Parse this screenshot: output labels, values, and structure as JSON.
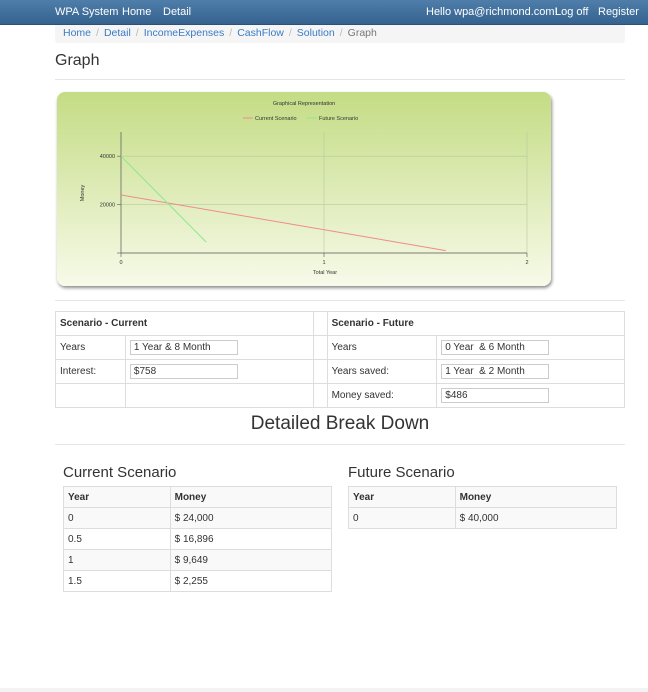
{
  "navbar": {
    "brand": "WPA System",
    "links": [
      "Home",
      "Detail"
    ],
    "greeting": "Hello wpa@richmond.com!",
    "logoff": "Log off",
    "register": "Register"
  },
  "breadcrumb": {
    "items": [
      "Home",
      "Detail",
      "IncomeExpenses",
      "CashFlow",
      "Solution"
    ],
    "active": "Graph"
  },
  "page_title": "Graph",
  "chart_data": {
    "type": "line",
    "title": "Graphical Representation",
    "xlabel": "Total Year",
    "ylabel": "Money",
    "xlim": [
      0,
      2
    ],
    "ylim": [
      0,
      50000
    ],
    "xticks": [
      "0",
      "1",
      "2"
    ],
    "yticks": [
      "20000",
      "40000"
    ],
    "grid": true,
    "legend": "top-center",
    "series": [
      {
        "name": "Current Scenario",
        "color": "#f08a8a",
        "x": [
          0,
          1.6
        ],
        "y": [
          24000,
          1000
        ]
      },
      {
        "name": "Future Scenario",
        "color": "#8fe88f",
        "x": [
          0,
          0.42
        ],
        "y": [
          40000,
          4500
        ]
      }
    ]
  },
  "scenario": {
    "current_header": "Scenario - Current",
    "future_header": "Scenario - Future",
    "current": {
      "years_label": "Years",
      "years_value": "1 Year & 8 Month",
      "interest_label": "Interest:",
      "interest_value": "$758"
    },
    "future": {
      "years_label": "Years",
      "years_value": "0 Year  & 6 Month",
      "years_saved_label": "Years saved:",
      "years_saved_value": "1 Year  & 2 Month",
      "money_saved_label": "Money saved:",
      "money_saved_value": "$486"
    }
  },
  "breakdown": {
    "heading": "Detailed Break Down",
    "current": {
      "title": "Current Scenario",
      "columns": [
        "Year",
        "Money"
      ],
      "rows": [
        [
          "0",
          "$ 24,000"
        ],
        [
          "0.5",
          "$ 16,896"
        ],
        [
          "1",
          "$ 9,649"
        ],
        [
          "1.5",
          "$ 2,255"
        ]
      ]
    },
    "future": {
      "title": "Future Scenario",
      "columns": [
        "Year",
        "Money"
      ],
      "rows": [
        [
          "0",
          "$ 40,000"
        ]
      ]
    }
  }
}
